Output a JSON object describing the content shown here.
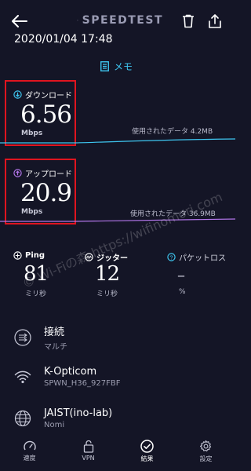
{
  "header": {
    "brand": "SPEEDTEST",
    "datetime": "2020/01/04 17:48",
    "memo_label": "メモ"
  },
  "download": {
    "label": "ダウンロード",
    "value": "6.56",
    "unit": "Mbps",
    "data_used": "使用されたデータ 4.2MB"
  },
  "upload": {
    "label": "アップロード",
    "value": "20.9",
    "unit": "Mbps",
    "data_used": "使用されたデータ 36.9MB"
  },
  "ping": {
    "label": "Ping",
    "value": "81",
    "unit": "ミリ秒"
  },
  "jitter": {
    "label": "ジッター",
    "value": "12",
    "unit": "ミリ秒"
  },
  "packet_loss": {
    "label": "パケットロス",
    "value": "–",
    "unit": "%"
  },
  "connection": {
    "title": "接続",
    "subtitle": "マルチ"
  },
  "network": {
    "title": "K-Opticom",
    "subtitle": "SPWN_H36_927FBF"
  },
  "server": {
    "title": "JAIST(ino-lab)",
    "subtitle": "Nomi"
  },
  "nav": [
    {
      "label": "速度"
    },
    {
      "label": "VPN"
    },
    {
      "label": "結果"
    },
    {
      "label": "設定"
    }
  ],
  "watermark": "© Wi-Fiの森 https://wifinomori.com",
  "colors": {
    "background": "#141526",
    "download_accent": "#3ec6f0",
    "upload_accent": "#b175e8",
    "highlight": "#e0141f"
  }
}
